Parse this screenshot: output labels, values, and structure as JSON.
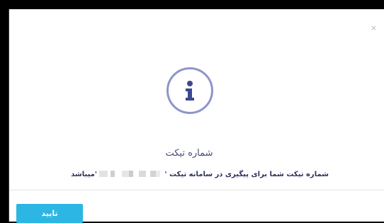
{
  "dialog": {
    "close_label": "×",
    "icon": "info-icon",
    "title": "شماره تیکت",
    "message_text": "شماره تیکت شما برای پیگیری در سامانه تیکت ' ",
    "message_suffix": "'میباشد",
    "confirm_label": "تایید"
  },
  "colors": {
    "icon_ring": "#8e95c9",
    "icon_glyph": "#3d4890",
    "button": "#2cb6e3",
    "text": "#2d3158"
  }
}
